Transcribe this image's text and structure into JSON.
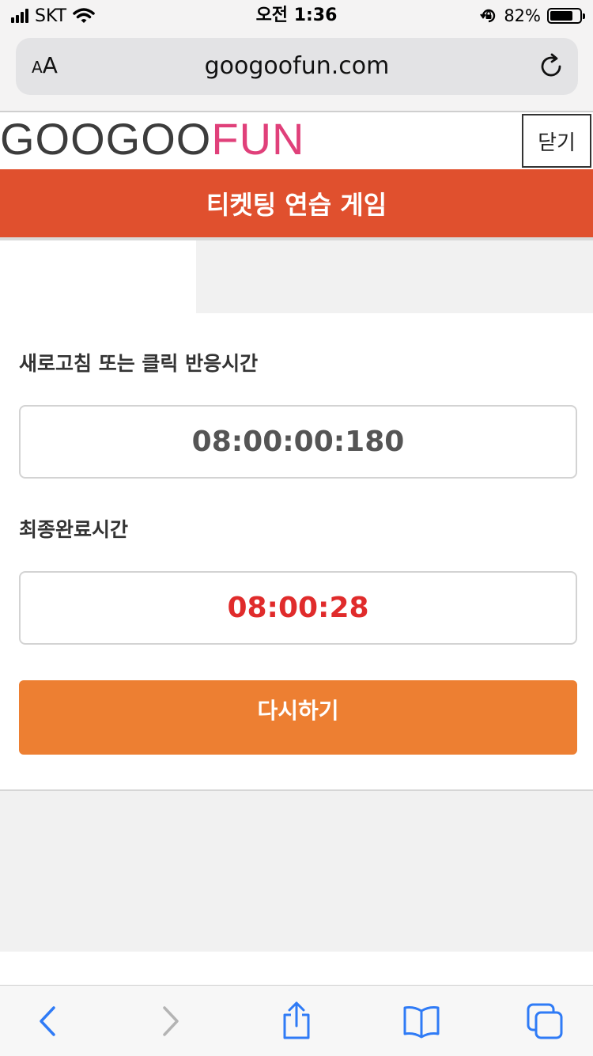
{
  "status_bar": {
    "carrier": "SKT",
    "time": "오전 1:36",
    "battery_percent": "82%",
    "battery_level": 0.82,
    "icons": [
      "signal-icon",
      "wifi-icon",
      "orientation-lock-icon",
      "battery-icon"
    ]
  },
  "browser": {
    "text_size_label_small": "A",
    "text_size_label_large": "A",
    "url": "googoofun.com",
    "icons": [
      "reload-icon"
    ]
  },
  "site": {
    "logo_part1": "GOOGOO",
    "logo_part2": "FUN",
    "close_label": "닫기",
    "page_title": "티켓팅 연습 게임"
  },
  "result": {
    "reaction_label": "새로고침 또는 클릭 반응시간",
    "reaction_value": "08:00:00:180",
    "final_label": "최종완료시간",
    "final_value": "08:00:28",
    "retry_label": "다시하기"
  },
  "toolbar": {
    "icons": [
      "back-icon",
      "forward-icon",
      "share-icon",
      "bookmarks-icon",
      "tabs-icon"
    ]
  },
  "colors": {
    "title_bar": "#e0502e",
    "retry_button": "#ed7f32",
    "final_time": "#e02b2b",
    "logo_accent": "#e0407a",
    "toolbar_icons": "#2f7bf6"
  }
}
